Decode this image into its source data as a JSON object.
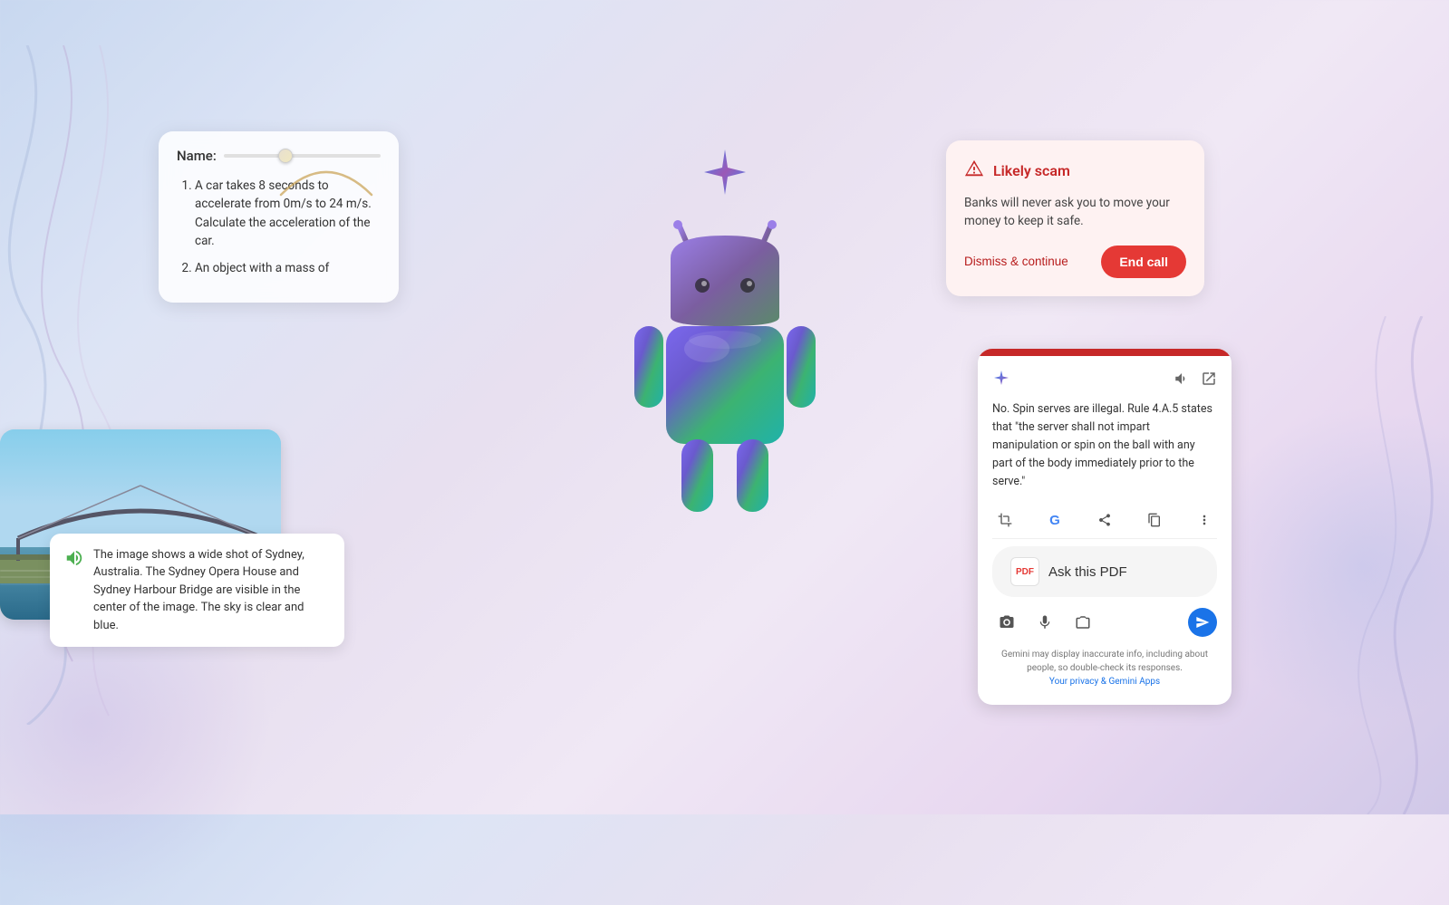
{
  "background": {
    "gradient": "linear-gradient(135deg, #c8d8f0, #dde4f5, #e8e0f0, #f0e8f5)"
  },
  "quiz_card": {
    "name_label": "Name:",
    "questions": [
      "A car takes 8 seconds to accelerate from 0m/s to 24 m/s. Calculate the acceleration of the car.",
      "An object with a mass of"
    ]
  },
  "sydney_card": {
    "caption": "The image shows a wide shot of Sydney, Australia. The Sydney Opera House and Sydney Harbour Bridge are visible in the center of the image. The sky is clear and blue."
  },
  "scam_card": {
    "title": "Likely scam",
    "body": "Banks will never ask you to move your money to keep it safe.",
    "dismiss_label": "Dismiss & continue",
    "end_call_label": "End call"
  },
  "gemini_panel": {
    "response_text": "No. Spin serves are illegal. Rule 4.A.5 states that \"the server shall not impart manipulation or spin on the ball with any part of the body immediately prior to the serve.\"",
    "ask_pdf_label": "Ask this PDF",
    "disclaimer_text": "Gemini may display inaccurate info, including about people, so double-check its responses.",
    "your_privacy_label": "Your privacy & Gemini Apps"
  },
  "icons": {
    "speaker": "🔊",
    "warning": "⚠",
    "gemini_star": "✦",
    "volume": "🔊",
    "external_link": "↗",
    "share": "⬆",
    "copy": "⧉",
    "more": "⋮",
    "camera": "📷",
    "mic": "🎤",
    "screenshot": "⊞",
    "send": "➤",
    "pdf": "PDF"
  }
}
